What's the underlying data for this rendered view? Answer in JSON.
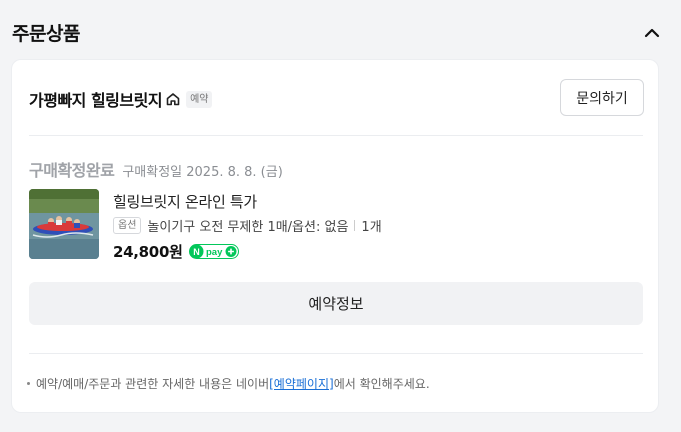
{
  "section": {
    "title": "주문상품"
  },
  "shop": {
    "name": "가평빠지 힐링브릿지",
    "badge": "예약",
    "inquiry_label": "문의하기"
  },
  "order": {
    "status": "구매확정완료",
    "status_date": "구매확정일 2025. 8. 8. (금)"
  },
  "product": {
    "name": "힐링브릿지 온라인 특가",
    "option_tag": "옵션",
    "option_text": "놀이기구 오전 무제한 1매/옵션: 없음",
    "quantity": "1개",
    "price": "24,800원",
    "pay_badge": "N pay +"
  },
  "actions": {
    "reservation_info_label": "예약정보"
  },
  "notice": {
    "before": "예약/예매/주문과 관련한 자세한 내용은 네이버 ",
    "link": "[예약페이지]",
    "after": "에서 확인해주세요."
  },
  "colors": {
    "npay_green": "#03c75a",
    "link_blue": "#1a6fd6",
    "status_gray": "#a0a3a8"
  }
}
